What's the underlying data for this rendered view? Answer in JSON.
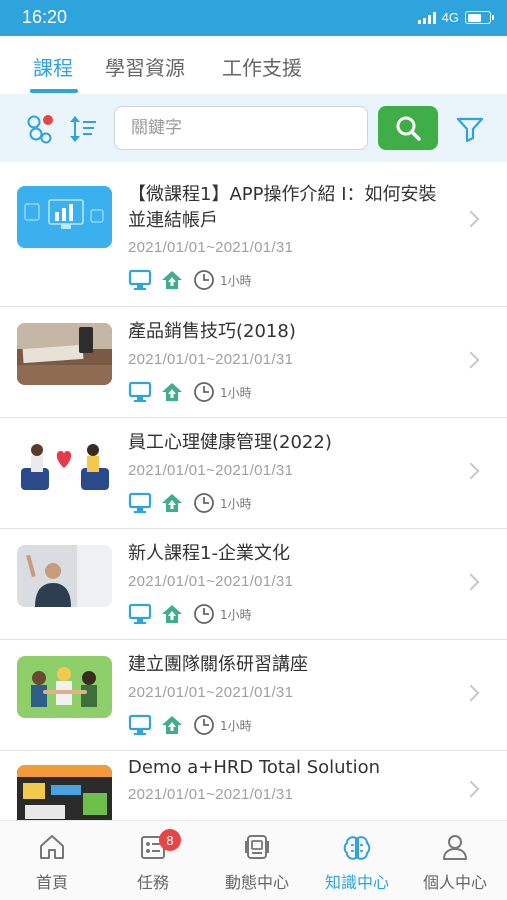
{
  "status_bar": {
    "time": "16:20",
    "network": "4G",
    "battery_level": 0.7
  },
  "tabs": [
    {
      "label": "課程",
      "active": true
    },
    {
      "label": "學習資源",
      "active": false
    },
    {
      "label": "工作支援",
      "active": false
    }
  ],
  "search": {
    "placeholder": "關鍵字"
  },
  "courses": [
    {
      "title": "【微課程1】APP操作介紹 I：如何安裝並連結帳戶",
      "date": "2021/01/01~2021/01/31",
      "duration": "1小時"
    },
    {
      "title": "產品銷售技巧(2018)",
      "date": "2021/01/01~2021/01/31",
      "duration": "1小時"
    },
    {
      "title": "員工心理健康管理(2022)",
      "date": "2021/01/01~2021/01/31",
      "duration": "1小時"
    },
    {
      "title": "新人課程1-企業文化",
      "date": "2021/01/01~2021/01/31",
      "duration": "1小時"
    },
    {
      "title": "建立團隊關係研習講座",
      "date": "2021/01/01~2021/01/31",
      "duration": "1小時"
    },
    {
      "title": "Demo a+HRD Total Solution",
      "date": "2021/01/01~2021/01/31",
      "duration": ""
    }
  ],
  "bottom_nav": [
    {
      "label": "首頁",
      "icon": "home-icon",
      "active": false
    },
    {
      "label": "任務",
      "icon": "task-icon",
      "active": false,
      "badge": "8"
    },
    {
      "label": "動態中心",
      "icon": "activity-icon",
      "active": false
    },
    {
      "label": "知識中心",
      "icon": "brain-icon",
      "active": true
    },
    {
      "label": "個人中心",
      "icon": "person-icon",
      "active": false
    }
  ],
  "colors": {
    "accent": "#2fa3dc",
    "search_button": "#3fae49",
    "badge": "#e64545",
    "status_icon": "#3fae8a"
  }
}
